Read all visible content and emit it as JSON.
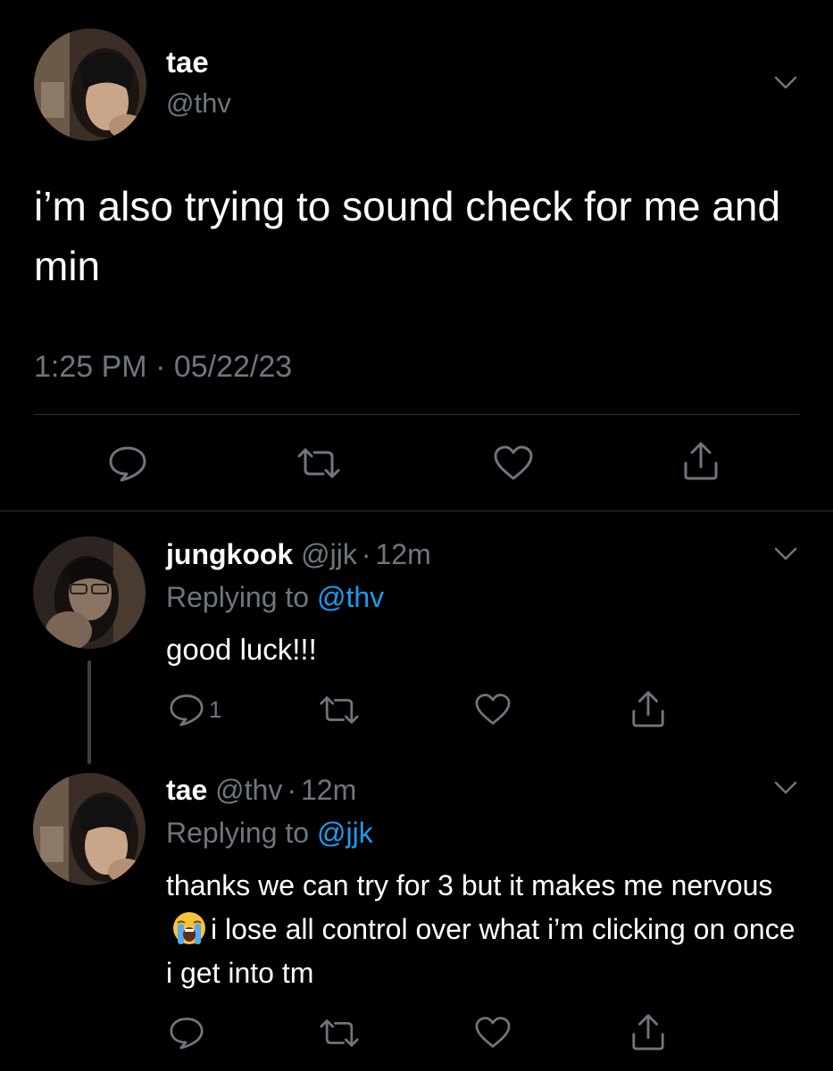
{
  "main_tweet": {
    "display_name": "tae",
    "handle": "@thv",
    "text": "i’m also trying to sound check for me and min",
    "timestamp": "1:25 PM · 05/22/23",
    "avatar_icon": "user-avatar-photo",
    "actions": [
      "reply-icon",
      "retweet-icon",
      "like-icon",
      "share-icon"
    ]
  },
  "replies": [
    {
      "display_name": "jungkook",
      "handle": "@jjk",
      "time": "12m",
      "replying_prefix": "Replying to",
      "replying_to": "@thv",
      "text": "good luck!!!",
      "reply_count": "1",
      "avatar_icon": "user-avatar-photo"
    },
    {
      "display_name": "tae",
      "handle": "@thv",
      "time": "12m",
      "replying_prefix": "Replying to",
      "replying_to": "@jjk",
      "text_before_emoji": "thanks we can try for 3 but it makes me nervous",
      "emoji": "loudly-crying-face-emoji",
      "text_after_emoji": "i lose all control over what i’m clicking on once i get into tm",
      "avatar_icon": "user-avatar-photo"
    }
  ],
  "separator": "·",
  "colors": {
    "background": "#000000",
    "text": "#e7e9ea",
    "muted": "#6e767d",
    "link": "#1d9bf0",
    "divider": "#2f3336"
  }
}
